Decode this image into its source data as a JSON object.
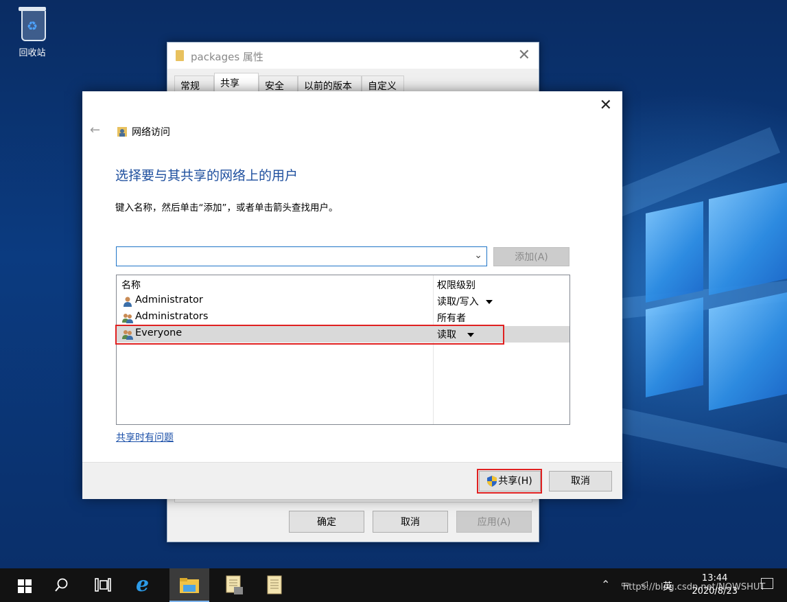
{
  "desktop": {
    "recycle_bin_label": "回收站"
  },
  "props_window": {
    "title": "packages 属性",
    "tabs": [
      "常规",
      "共享",
      "安全",
      "以前的版本",
      "自定义"
    ],
    "active_tab": "共享",
    "buttons": {
      "ok": "确定",
      "cancel": "取消",
      "apply": "应用(A)"
    }
  },
  "dialog": {
    "breadcrumb": "网络访问",
    "heading": "选择要与其共享的网络上的用户",
    "instruction": "键入名称，然后单击“添加”，或者单击箭头查找用户。",
    "name_input": {
      "value": "",
      "placeholder": ""
    },
    "add_button": "添加(A)",
    "columns": {
      "name": "名称",
      "permission": "权限级别"
    },
    "users": [
      {
        "name": "Administrator",
        "permission": "读取/写入",
        "has_dropdown": true,
        "icon": "single-user-icon"
      },
      {
        "name": "Administrators",
        "permission": "所有者",
        "has_dropdown": false,
        "icon": "user-group-icon"
      },
      {
        "name": "Everyone",
        "permission": "读取",
        "has_dropdown": true,
        "icon": "user-group-icon",
        "selected": true
      }
    ],
    "help_link": "共享时有问题",
    "share_button": "共享(H)",
    "cancel_button": "取消"
  },
  "taskbar": {
    "language": "英",
    "time": "13:44",
    "date": "2020/8/23"
  },
  "watermark": "https://blog.csdn.net/NOWSHUT"
}
